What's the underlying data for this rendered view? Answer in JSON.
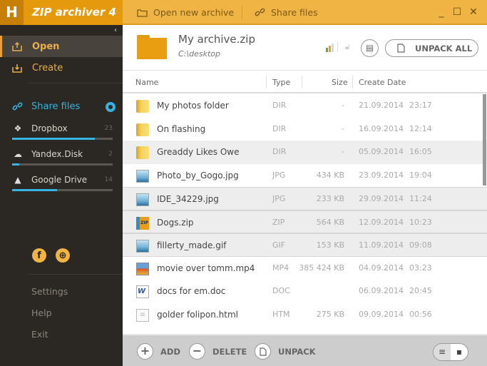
{
  "titlebar": {
    "logo": "H",
    "app_title": "ZIP archiver 4",
    "open_new_archive": "Open new archive",
    "share_files": "Share files",
    "minimize": "_",
    "maximize": "☐",
    "close": "✕"
  },
  "sidebar": {
    "collapse": "‹",
    "nav": [
      {
        "label": "Open",
        "icon": "upload-tray-icon",
        "active": true
      },
      {
        "label": "Create",
        "icon": "download-tray-icon",
        "active": false
      }
    ],
    "share": {
      "label": "Share files",
      "clouds": [
        {
          "name": "Dropbox",
          "count": "23",
          "usage": 0.82
        },
        {
          "name": "Yandex.Disk",
          "count": "2",
          "usage": 0.07
        },
        {
          "name": "Google Drive",
          "count": "14",
          "usage": 0.45
        }
      ]
    },
    "social": {
      "facebook": "f",
      "web": "⊕"
    },
    "footer": [
      "Settings",
      "Help",
      "Exit"
    ]
  },
  "archive": {
    "name": "My archive.zip",
    "path": "C:\\desktop",
    "unpack_all": "UNPACK ALL",
    "signal_colors": [
      "#6aa82b",
      "#e9a21a",
      "#d8d8d8"
    ]
  },
  "columns": {
    "name": "Name",
    "type": "Type",
    "size": "Size",
    "date": "Create Date"
  },
  "files": [
    {
      "name": "My photos folder",
      "type": "DIR",
      "size": "-",
      "date": "21.09.2014",
      "time": "23:17",
      "icon": "folder"
    },
    {
      "name": "On flashing",
      "type": "DIR",
      "size": "-",
      "date": "16.09.2014",
      "time": "12:14",
      "icon": "folder"
    },
    {
      "name": "Greaddy Likes Owe",
      "type": "DIR",
      "size": "-",
      "date": "05.09.2014",
      "time": "16:05",
      "icon": "folder"
    },
    {
      "name": "Photo_by_Gogo.jpg",
      "type": "JPG",
      "size": "434 KB",
      "date": "23.09.2014",
      "time": "19:04",
      "icon": "image"
    },
    {
      "name": "IDE_34229.jpg",
      "type": "JPG",
      "size": "233 KB",
      "date": "29.09.2014",
      "time": "11:24",
      "icon": "image"
    },
    {
      "name": "Dogs.zip",
      "type": "ZIP",
      "size": "564 KB",
      "date": "12.09.2014",
      "time": "10:23",
      "icon": "zip"
    },
    {
      "name": "fillerty_made.gif",
      "type": "GIF",
      "size": "153 KB",
      "date": "11.09.2014",
      "time": "09:08",
      "icon": "image"
    },
    {
      "name": "movie over tomm.mp4",
      "type": "MP4",
      "size": "385 424 KB",
      "date": "04.09.2014",
      "time": "03:23",
      "icon": "video"
    },
    {
      "name": "docs for em.doc",
      "type": "DOC",
      "size": "",
      "date": "06.09.2014",
      "time": "20:45",
      "icon": "word"
    },
    {
      "name": "golder folipon.html",
      "type": "HTM",
      "size": "275 KB",
      "date": "09.09.2014",
      "time": "00:56",
      "icon": "html"
    }
  ],
  "bottombar": {
    "add": "ADD",
    "delete": "DELETE",
    "unpack": "UNPACK",
    "add_sym": "+",
    "delete_sym": "−",
    "list_view": "≡",
    "grid_view": "▪"
  }
}
